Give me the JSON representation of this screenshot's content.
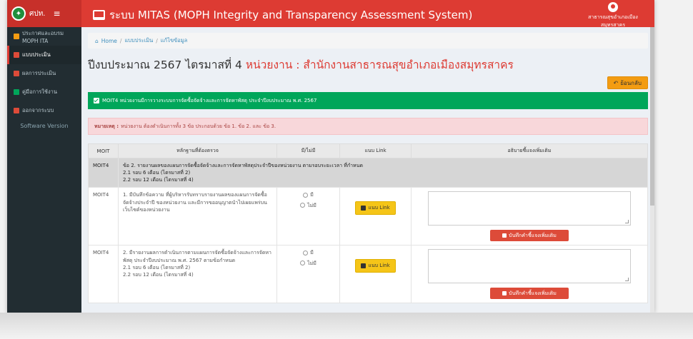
{
  "topbar": {
    "brand_name": "ศปท.",
    "menu_symbol": "≡",
    "system_title": "ระบบ MITAS (MOPH Integrity and Transparency Assessment System)",
    "user_name": "สาธารณสุขอำเภอเมืองสมุทรสาคร"
  },
  "sidebar": {
    "items": [
      {
        "label": "ประกาศและอบรม MOPH ITA",
        "icon": "megaphone-icon",
        "color": "#f39c12"
      },
      {
        "label": "แบบประเมิน",
        "icon": "document-icon",
        "color": "#dd4b39"
      },
      {
        "label": "ผลการประเมิน",
        "icon": "chart-icon",
        "color": "#dd4b39"
      },
      {
        "label": "คู่มือการใช้งาน",
        "icon": "book-icon",
        "color": "#00a65a"
      },
      {
        "label": "ออกจากระบบ",
        "icon": "logout-icon",
        "color": "#dd4b39"
      }
    ],
    "version_label": "Software Version"
  },
  "breadcrumb": {
    "home": "Home",
    "level1": "แบบประเมิน",
    "level2": "แก้ไขข้อมูล"
  },
  "heading": {
    "prefix": "ปีงบประมาณ 2567 ไตรมาสที่ 4",
    "unit_label": "หน่วยงาน : สำนักงานสาธารณสุขอำเภอเมืองสมุทรสาคร"
  },
  "back_button": "ย้อนกลับ",
  "green_bar": "MOIT4 หน่วยงานมีการวางระบบการจัดซื้อจัดจ้างและการจัดหาพัสดุ ประจำปีงบประมาณ พ.ศ. 2567",
  "note": {
    "label": "หมายเหตุ :",
    "text": "หน่วยงาน ต้องดำเนินการทั้ง 3 ข้อ ประกอบด้วย ข้อ 1. ข้อ 2. และ ข้อ 3."
  },
  "table": {
    "headers": [
      "MOIT",
      "หลักฐานที่ต้องตรวจ",
      "มี/ไม่มี",
      "แนบ Link",
      "อธิบายชี้แจงเพิ่มเติม"
    ],
    "group_row": {
      "code": "MOIT4",
      "line1": "ข้อ 2. รายงานผลของแผนการจัดซื้อจัดจ้างและการจัดหาพัสดุประจำปีของหน่วยงาน ตามรอบระยะเวลา ที่กำหนด",
      "line2": "2.1 รอบ 6 เดือน (ไตรมาสที่ 2)",
      "line3": "2.2 รอบ 12 เดือน (ไตรมาสที่ 4)"
    },
    "rows": [
      {
        "code": "MOIT4",
        "text": "1. มีบันทึกข้อความ ที่ผู้บริหารรับทราบรายงานผลของแผนการจัดซื้อจัดจ้างประจำปี ของหน่วยงาน และมีการขออนุญาตนำไปเผยแพร่บนเว็บไซต์ของหน่วยงาน",
        "yes_label": "มี",
        "no_label": "ไม่มี",
        "link_label": "แนบ Link",
        "save_label": "บันทึกคำชี้แจงเพิ่มเติม"
      },
      {
        "code": "MOIT4",
        "text": "2. มีรายงานผลการดำเนินการตามแผนการจัดซื้อจัดจ้างและการจัดหาพัสดุ ประจำปีงบประมาณ พ.ศ. 2567 ตามข้อกำหนด",
        "sub1": "2.1 รอบ 6 เดือน (ไตรมาสที่ 2)",
        "sub2": "2.2 รอบ 12 เดือน (ไตรมาสที่ 4)",
        "yes_label": "มี",
        "no_label": "ไม่มี",
        "link_label": "แนบ Link",
        "save_label": "บันทึกคำชี้แจงเพิ่มเติม"
      }
    ]
  },
  "colors": {
    "topbar": "#dd3b33",
    "sidebar": "#222d32",
    "success": "#00a65a",
    "warning": "#f39c12",
    "danger": "#dd4b39"
  }
}
